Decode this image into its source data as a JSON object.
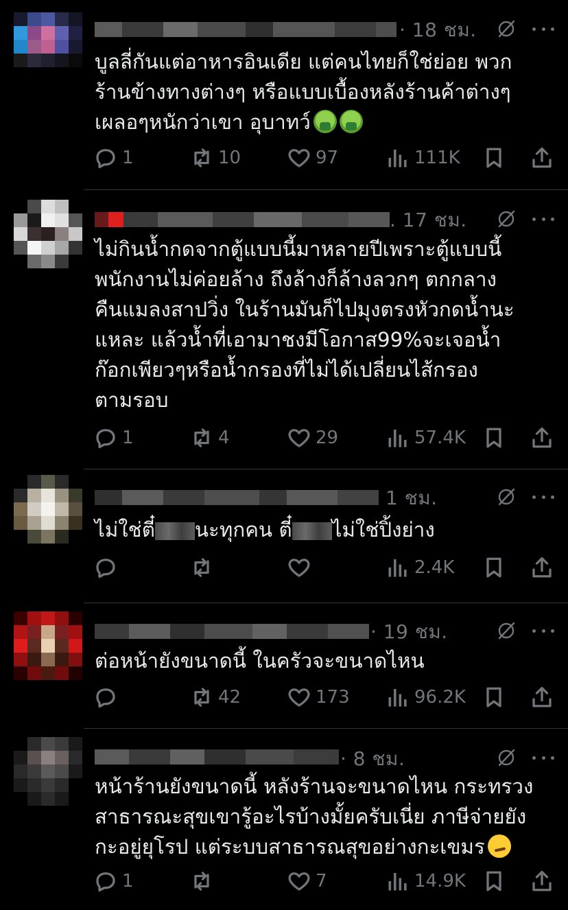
{
  "posts": [
    {
      "time": "· 18 ชม.",
      "lines": [
        "บูลลี่กันแต่อาหารอินเดีย แต่คนไทยก็ใช่ย่อย พวก",
        "ร้านข้างทางต่างๆ หรือแบบเบื้องหลังร้านค้าต่างๆ",
        "เผลอๆหนักว่าเขา อุบาทว์"
      ],
      "emojis": [
        "nauseated-face",
        "nauseated-face"
      ],
      "replies": "1",
      "reposts": "10",
      "likes": "97",
      "views": "111K"
    },
    {
      "time": ". 17 ชม.",
      "lines": [
        "ไม่กินน้ำกดจากตู้แบบนี้มาหลายปีเพราะตู้แบบนี้",
        "พนักงานไม่ค่อยล้าง ถึงล้างก็ล้างลวกๆ ตกกลาง",
        "คืนแมลงสาปวิ่ง ในร้านมันก็ไปมุงตรงหัวกดน้ำนะ",
        "แหละ  แล้วน้ำที่เอามาชงมีโอกาส99%จะเจอน้ำ",
        "ก๊อกเพียวๆหรือน้ำกรองที่ไม่ได้เปลี่ยนไส้กรอง",
        "ตามรอบ"
      ],
      "replies": "1",
      "reposts": "4",
      "likes": "29",
      "views": "57.4K"
    },
    {
      "time": "1 ชม.",
      "segments": [
        "ไม่ใช่ตี๋",
        "นะทุกคน ตี๋",
        "ไม่ใช่ปิ้งย่าง"
      ],
      "replies": "",
      "reposts": "",
      "likes": "",
      "views": "2.4K"
    },
    {
      "time": "· 19 ชม.",
      "lines": [
        "ต่อหน้ายังขนาดนี้ ในครัวจะขนาดไหน"
      ],
      "replies": "",
      "reposts": "42",
      "likes": "173",
      "views": "96.2K"
    },
    {
      "time": "· 8 ชม.",
      "lines": [
        "หน้าร้านยังขนาดนี้ หลังร้านจะขนาดไหน กระทรวง",
        "สาธารณะสุขเขารู้อะไรบ้างมั้ยครับเนี่ย ภาษีจ่ายยัง",
        "กะอยู่ยุโรป แต่ระบบสาธารณสุขอย่างกะเขมร"
      ],
      "emojis": [
        "smirking-face"
      ],
      "replies": "1",
      "reposts": "",
      "likes": "7",
      "views": "14.9K"
    }
  ]
}
